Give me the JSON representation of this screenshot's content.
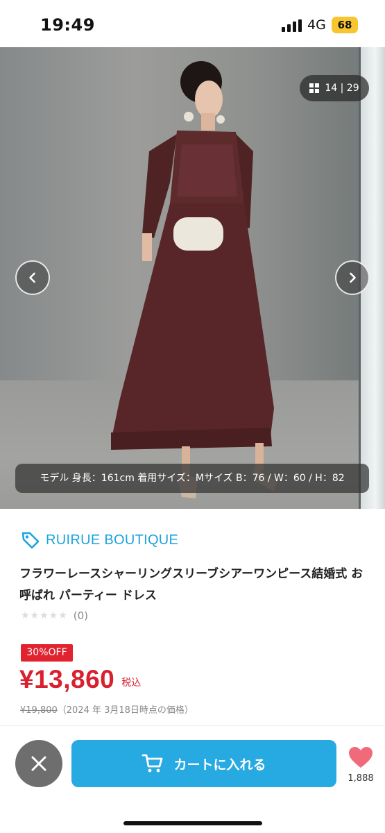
{
  "status_bar": {
    "time": "19:49",
    "network": "4G",
    "battery": "68"
  },
  "gallery": {
    "counter": "14 | 29",
    "counter_icon": "grid-icon",
    "prev_icon": "chevron-left-icon",
    "next_icon": "chevron-right-icon",
    "model_caption": "モデル 身長：161cm 着用サイズ：Mサイズ B：76 / W：60 / H：82"
  },
  "product": {
    "shop_name": "RUIRUE BOUTIQUE",
    "shop_icon": "tag-icon",
    "title": "フラワーレースシャーリングスリーブシアーワンピース結婚式 お呼ばれ パーティー ドレス",
    "stars": "★★★★★",
    "rating_count": "(0)",
    "rating_value": 0,
    "discount_badge": "30%OFF",
    "price": "¥13,860",
    "tax_label": "税込",
    "original_price": "¥19,800",
    "original_note": "（2024 年 3月18日時点の価格）"
  },
  "bottom_bar": {
    "close_icon": "close-icon",
    "cart_icon": "cart-icon",
    "cart_label": "カートに入れる",
    "favorite_icon": "heart-icon",
    "favorite_count": "1,888"
  },
  "colors": {
    "accent": "#27a9e1",
    "shop": "#1ba3dd",
    "price": "#d9202f",
    "favorite": "#f06a7a",
    "dress": "#5a2a2c"
  }
}
